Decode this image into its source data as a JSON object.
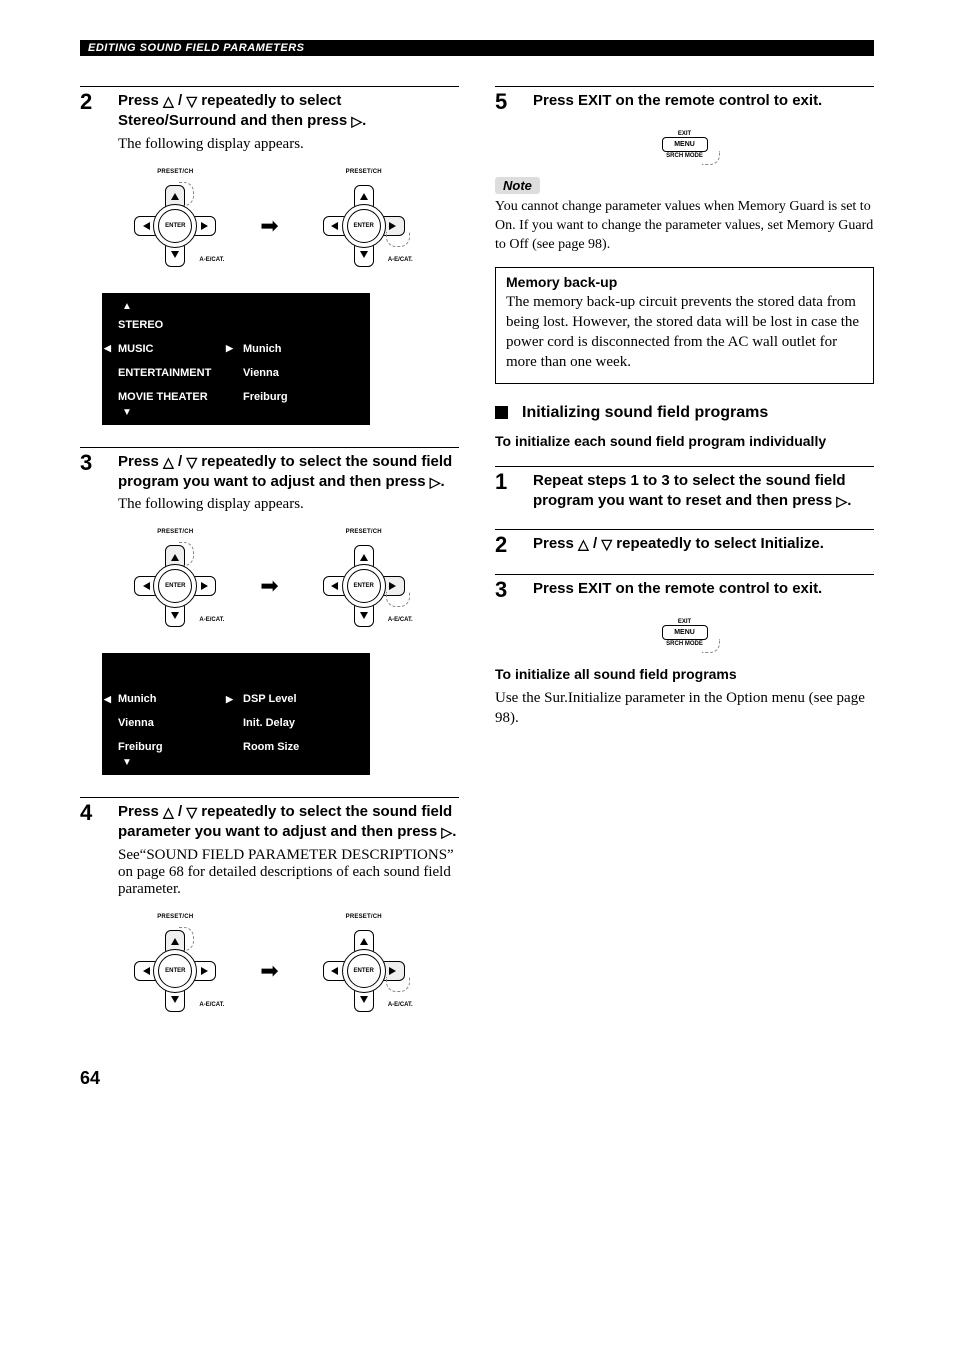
{
  "header_bar": "EDITING SOUND FIELD PARAMETERS",
  "page_number": "64",
  "glyphs": {
    "up": "△",
    "down": "▽",
    "right": "▷",
    "slash": " / "
  },
  "remote": {
    "top_label": "PRESET/CH",
    "bottom_right_label": "A-E/CAT.",
    "center_label": "ENTER"
  },
  "menu_button": {
    "top": "EXIT",
    "mid": "MENU",
    "bot": "SRCH MODE"
  },
  "left": {
    "step2": {
      "num": "2",
      "instr_pre": "Press ",
      "instr_mid": " repeatedly to select Stereo/Surround and then press ",
      "instr_post": ".",
      "follow": "The following display appears."
    },
    "screen2": {
      "left_rows": [
        "STEREO",
        "MUSIC",
        "ENTERTAINMENT",
        "MOVIE THEATER"
      ],
      "right_rows": [
        "",
        "Munich",
        "Vienna",
        "Freiburg"
      ],
      "selected_left_index": 1
    },
    "step3": {
      "num": "3",
      "instr_pre": "Press ",
      "instr_mid": " repeatedly to select the sound field program you want to adjust and then press ",
      "instr_post": ".",
      "follow": "The following display appears."
    },
    "screen3": {
      "left_rows": [
        "Munich",
        "Vienna",
        "Freiburg"
      ],
      "right_rows": [
        "DSP Level",
        "Init. Delay",
        "Room Size"
      ],
      "selected_left_index": 0
    },
    "step4": {
      "num": "4",
      "instr_pre": "Press ",
      "instr_mid": " repeatedly to select the sound field parameter you want to adjust and then press ",
      "instr_post": ".",
      "follow": "See“SOUND FIELD PARAMETER DESCRIPTIONS” on page 68 for detailed descriptions of each sound field parameter."
    }
  },
  "right": {
    "step5": {
      "num": "5",
      "instr": "Press EXIT on the remote control to exit."
    },
    "note_label": "Note",
    "note_text": "You cannot change parameter values when Memory Guard is set to On. If you want to change the parameter values, set Memory Guard to Off (see page 98).",
    "box_title": "Memory back-up",
    "box_body": "The memory back-up circuit prevents the stored data from being lost. However, the stored data will be lost in case the power cord is disconnected from the AC wall outlet for more than one week.",
    "init_heading": "Initializing sound field programs",
    "init_sub": "To initialize each sound field program individually",
    "i1": {
      "num": "1",
      "instr_pre": "Repeat steps 1 to 3 to select the sound field program you want to reset and then press ",
      "instr_post": "."
    },
    "i2": {
      "num": "2",
      "instr_pre": "Press ",
      "instr_mid": " repeatedly to select Initialize."
    },
    "i3": {
      "num": "3",
      "instr": "Press EXIT on the remote control to exit."
    },
    "all_title": "To initialize all sound field programs",
    "all_body": "Use the Sur.Initialize parameter in the Option menu (see page 98)."
  }
}
